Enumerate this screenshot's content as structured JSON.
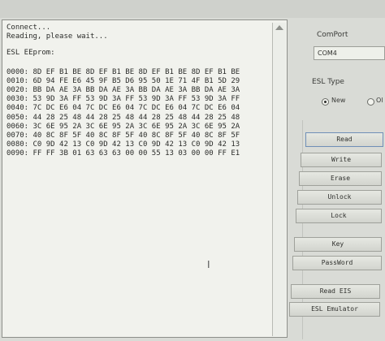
{
  "log": {
    "connect_line": "Connect...",
    "reading_line": "Reading, please wait...",
    "eeprom_label": "ESL EEprom:",
    "rows": [
      "0000: 8D EF B1 BE 8D EF B1 BE 8D EF B1 BE 8D EF B1 BE",
      "0010: 6D 94 FE E6 45 9F B5 D6 95 50 1E 71 4F B1 5D 29",
      "0020: BB DA AE 3A BB DA AE 3A BB DA AE 3A BB DA AE 3A",
      "0030: 53 9D 3A FF 53 9D 3A FF 53 9D 3A FF 53 9D 3A FF",
      "0040: 7C DC E6 04 7C DC E6 04 7C DC E6 04 7C DC E6 04",
      "0050: 44 28 25 48 44 28 25 48 44 28 25 48 44 28 25 48",
      "0060: 3C 6E 95 2A 3C 6E 95 2A 3C 6E 95 2A 3C 6E 95 2A",
      "0070: 40 8C 8F 5F 40 8C 8F 5F 40 8C 8F 5F 40 8C 8F 5F",
      "0080: C0 9D 42 13 C0 9D 42 13 C0 9D 42 13 C0 9D 42 13",
      "0090: FF FF 3B 01 63 63 63 00 00 55 13 03 00 00 FF E1"
    ]
  },
  "comport": {
    "label": "ComPort",
    "value": "COM4"
  },
  "esl_type": {
    "label": "ESL Type",
    "option_new": "New",
    "option_old": "Ol"
  },
  "buttons": {
    "read": "Read",
    "write": "Write",
    "erase": "Erase",
    "unlock": "Unlock",
    "lock": "Lock",
    "key": "Key",
    "password": "PassWord",
    "read_eis": "Read EIS",
    "esl_emulator": "ESL Emulator"
  },
  "icons": {
    "scroll_up": "triangle-up-icon",
    "text_cursor": "i-beam-cursor-icon"
  }
}
